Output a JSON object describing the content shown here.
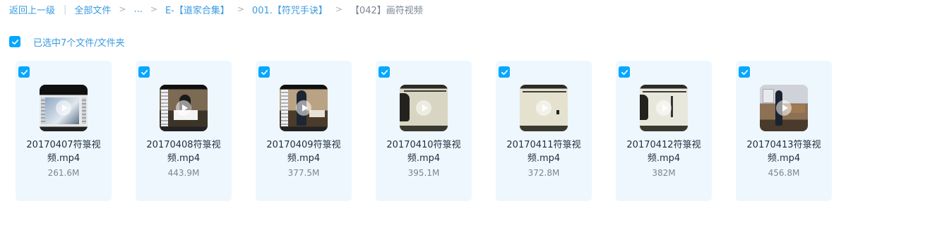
{
  "breadcrumb": {
    "back": "返回上一级",
    "all_files": "全部文件",
    "ellipsis": "...",
    "level1": "E-【道家合集】",
    "level2": "001.【符咒手诀】",
    "current": "【042】画符视频"
  },
  "selection": {
    "label": "已选中7个文件/文件夹",
    "all_checked": true
  },
  "files": [
    {
      "name": "20170407符箓视频.mp4",
      "size": "261.6M",
      "checked": true
    },
    {
      "name": "20170408符箓视频.mp4",
      "size": "443.9M",
      "checked": true
    },
    {
      "name": "20170409符箓视频.mp4",
      "size": "377.5M",
      "checked": true
    },
    {
      "name": "20170410符箓视频.mp4",
      "size": "395.1M",
      "checked": true
    },
    {
      "name": "20170411符箓视频.mp4",
      "size": "372.8M",
      "checked": true
    },
    {
      "name": "20170412符箓视频.mp4",
      "size": "382M",
      "checked": true
    },
    {
      "name": "20170413符箓视频.mp4",
      "size": "456.8M",
      "checked": true
    }
  ],
  "colors": {
    "accent": "#06a7ff",
    "link": "#3a9be0",
    "card_bg": "#eef7fe"
  },
  "icons": {
    "checkbox": "check-icon",
    "play": "play-icon"
  }
}
